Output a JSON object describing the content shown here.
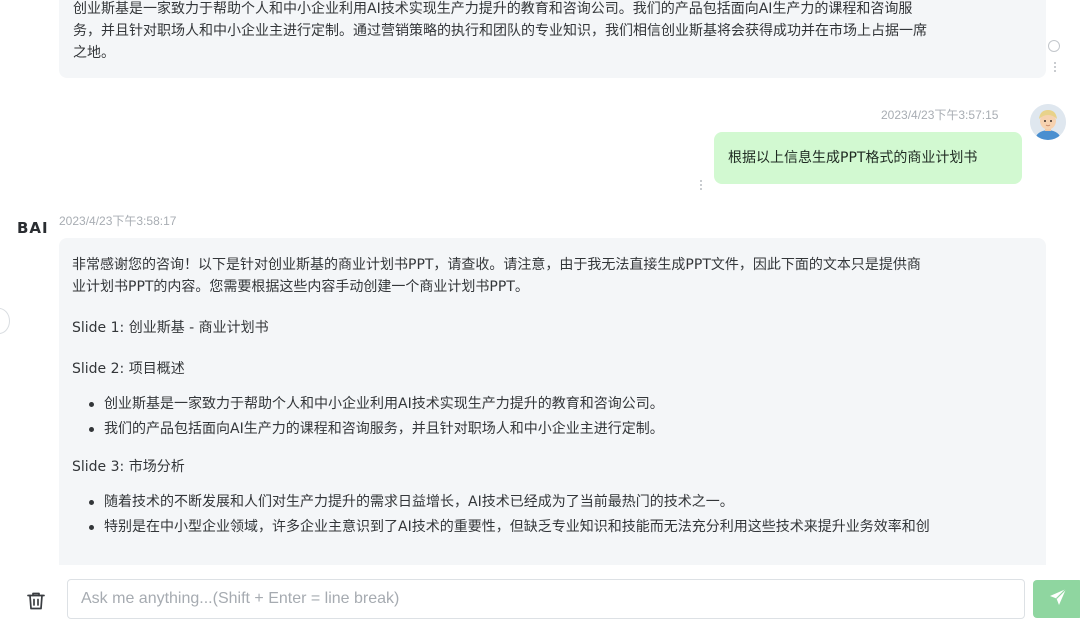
{
  "messages": {
    "top_ai": {
      "text_line1": "创业斯基是一家致力于帮助个人和中小企业利用AI技术实现生产力提升的教育和咨询公司。我们的产品包括面向AI生产力的课程和咨询服",
      "text_line2": "务，并且针对职场人和中小企业主进行定制。通过营销策略的执行和团队的专业知识，我们相信创业斯基将会获得成功并在市场上占据一席",
      "text_line3": "之地。"
    },
    "user": {
      "timestamp": "2023/4/23下午3:57:15",
      "text": "根据以上信息生成PPT格式的商业计划书",
      "avatar_icon": "user-avatar-icon"
    },
    "ai_reply": {
      "logo": "BAI",
      "timestamp": "2023/4/23下午3:58:17",
      "intro_line1": "非常感谢您的咨询！以下是针对创业斯基的商业计划书PPT，请查收。请注意，由于我无法直接生成PPT文件，因此下面的文本只是提供商",
      "intro_line2": "业计划书PPT的内容。您需要根据这些内容手动创建一个商业计划书PPT。",
      "slide1": "Slide 1: 创业斯基 - 商业计划书",
      "slide2": "Slide 2: 项目概述",
      "slide2_bullets": [
        "创业斯基是一家致力于帮助个人和中小企业利用AI技术实现生产力提升的教育和咨询公司。",
        "我们的产品包括面向AI生产力的课程和咨询服务，并且针对职场人和中小企业主进行定制。"
      ],
      "slide3": "Slide 3: 市场分析",
      "slide3_bullets": [
        "随着技术的不断发展和人们对生产力提升的需求日益增长，AI技术已经成为了当前最热门的技术之一。",
        "特别是在中小型企业领域，许多企业主意识到了AI技术的重要性，但缺乏专业知识和技能而无法充分利用这些技术来提升业务效率和创"
      ]
    }
  },
  "input": {
    "placeholder": "Ask me anything...(Shift + Enter = line break)",
    "clear_icon": "trash-icon",
    "send_icon": "send-icon"
  },
  "colors": {
    "ai_bubble": "#f4f6f8",
    "user_bubble": "#d2f9d1",
    "send_button": "#8fd6a0",
    "timestamp": "#a8adb3"
  }
}
